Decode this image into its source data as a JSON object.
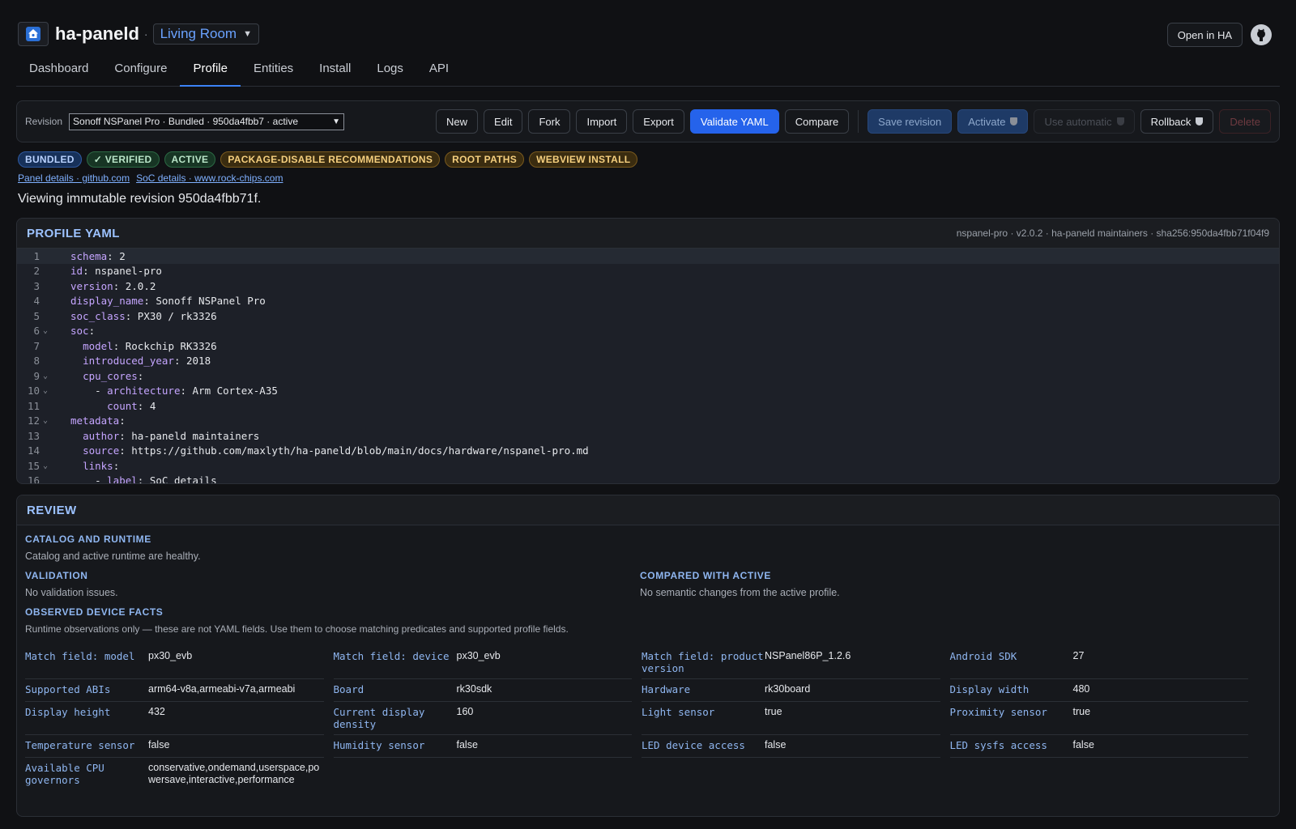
{
  "header": {
    "app_title": "ha-paneld",
    "separator": "·",
    "room": "Living Room",
    "open_in_ha": "Open in HA"
  },
  "tabs": [
    "Dashboard",
    "Configure",
    "Profile",
    "Entities",
    "Install",
    "Logs",
    "API"
  ],
  "revision": {
    "label": "Revision",
    "selected": "Sonoff NSPanel Pro · Bundled · 950da4fbb7 · active",
    "buttons": {
      "new": "New",
      "edit": "Edit",
      "fork": "Fork",
      "import": "Import",
      "export": "Export",
      "validate": "Validate YAML",
      "compare": "Compare",
      "save": "Save revision",
      "activate": "Activate",
      "use_automatic": "Use automatic",
      "rollback": "Rollback",
      "delete": "Delete"
    }
  },
  "badges": [
    "BUNDLED",
    "✓ VERIFIED",
    "ACTIVE",
    "PACKAGE-DISABLE RECOMMENDATIONS",
    "ROOT PATHS",
    "WEBVIEW INSTALL"
  ],
  "links": [
    "Panel details · github.com",
    "SoC details · www.rock-chips.com"
  ],
  "viewing_text": "Viewing immutable revision 950da4fbb71f.",
  "yaml": {
    "title": "PROFILE YAML",
    "meta": "nspanel-pro · v2.0.2 · ha-paneld maintainers · sha256:950da4fbb71f04f9",
    "lines": [
      {
        "n": "1",
        "fold": false,
        "indent": "",
        "key": "schema",
        "value": " 2"
      },
      {
        "n": "2",
        "fold": false,
        "indent": "",
        "key": "id",
        "value": " nspanel-pro"
      },
      {
        "n": "3",
        "fold": false,
        "indent": "",
        "key": "version",
        "value": " 2.0.2"
      },
      {
        "n": "4",
        "fold": false,
        "indent": "",
        "key": "display_name",
        "value": " Sonoff NSPanel Pro"
      },
      {
        "n": "5",
        "fold": false,
        "indent": "",
        "key": "soc_class",
        "value": " PX30 / rk3326"
      },
      {
        "n": "6",
        "fold": true,
        "indent": "",
        "key": "soc",
        "value": ""
      },
      {
        "n": "7",
        "fold": false,
        "indent": "  ",
        "key": "model",
        "value": " Rockchip RK3326"
      },
      {
        "n": "8",
        "fold": false,
        "indent": "  ",
        "key": "introduced_year",
        "value": " 2018"
      },
      {
        "n": "9",
        "fold": true,
        "indent": "  ",
        "key": "cpu_cores",
        "value": ""
      },
      {
        "n": "10",
        "fold": true,
        "indent": "    - ",
        "key": "architecture",
        "value": " Arm Cortex-A35"
      },
      {
        "n": "11",
        "fold": false,
        "indent": "      ",
        "key": "count",
        "value": " 4"
      },
      {
        "n": "12",
        "fold": true,
        "indent": "",
        "key": "metadata",
        "value": ""
      },
      {
        "n": "13",
        "fold": false,
        "indent": "  ",
        "key": "author",
        "value": " ha-paneld maintainers"
      },
      {
        "n": "14",
        "fold": false,
        "indent": "  ",
        "key": "source",
        "value": " https://github.com/maxlyth/ha-paneld/blob/main/docs/hardware/nspanel-pro.md"
      },
      {
        "n": "15",
        "fold": true,
        "indent": "  ",
        "key": "links",
        "value": ""
      },
      {
        "n": "16",
        "fold": false,
        "indent": "    - ",
        "key": "label",
        "value": " SoC details"
      }
    ]
  },
  "review": {
    "title": "REVIEW",
    "catalog_title": "CATALOG AND RUNTIME",
    "catalog_text": "Catalog and active runtime are healthy.",
    "validation_title": "VALIDATION",
    "validation_text": "No validation issues.",
    "compared_title": "COMPARED WITH ACTIVE",
    "compared_text": "No semantic changes from the active profile.",
    "facts_title": "OBSERVED DEVICE FACTS",
    "facts_text": "Runtime observations only — these are not YAML fields. Use them to choose matching predicates and supported profile fields.",
    "facts": [
      {
        "key": "Match field: model",
        "value": "px30_evb"
      },
      {
        "key": "Match field: device",
        "value": "px30_evb"
      },
      {
        "key": "Match field: product version",
        "value": "NSPanel86P_1.2.6"
      },
      {
        "key": "Android SDK",
        "value": "27"
      },
      {
        "key": "Supported ABIs",
        "value": "arm64-v8a,armeabi-v7a,armeabi"
      },
      {
        "key": "Board",
        "value": "rk30sdk"
      },
      {
        "key": "Hardware",
        "value": "rk30board"
      },
      {
        "key": "Display width",
        "value": "480"
      },
      {
        "key": "Display height",
        "value": "432"
      },
      {
        "key": "Current display density",
        "value": "160"
      },
      {
        "key": "Light sensor",
        "value": "true"
      },
      {
        "key": "Proximity sensor",
        "value": "true"
      },
      {
        "key": "Temperature sensor",
        "value": "false"
      },
      {
        "key": "Humidity sensor",
        "value": "false"
      },
      {
        "key": "LED device access",
        "value": "false"
      },
      {
        "key": "LED sysfs access",
        "value": "false"
      },
      {
        "key": "Available CPU governors",
        "value": "conservative,ondemand,userspace,powersave,interactive,performance"
      }
    ]
  }
}
